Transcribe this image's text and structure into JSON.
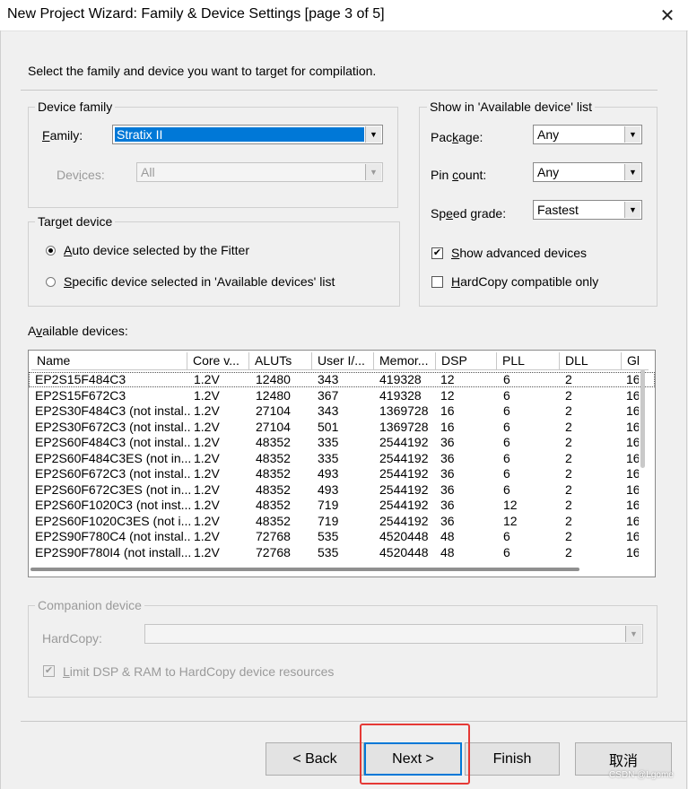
{
  "window": {
    "title": "New Project Wizard: Family & Device Settings [page 3 of 5]",
    "close_glyph": "✕"
  },
  "intro": "Select the family and device you want to target for compilation.",
  "device_family": {
    "group_label": "Device family",
    "family_label_u": "F",
    "family_label_rest": "amily:",
    "family_value": "Stratix II",
    "devices_label_a": "Dev",
    "devices_label_u": "i",
    "devices_label_b": "ces:",
    "devices_value": "All"
  },
  "target_device": {
    "group_label": "Target device",
    "auto_u": "A",
    "auto_rest": "uto device selected by the Fitter",
    "specific_u": "S",
    "specific_rest": "pecific device selected in 'Available devices' list",
    "selected": "auto"
  },
  "show_list": {
    "group_label": "Show in 'Available device' list",
    "package_label_a": "Pac",
    "package_label_u": "k",
    "package_label_b": "age:",
    "package_value": "Any",
    "pin_count_label_a": "Pin ",
    "pin_count_label_u": "c",
    "pin_count_label_b": "ount:",
    "pin_count_value": "Any",
    "speed_label_a": "Sp",
    "speed_label_u": "e",
    "speed_label_b": "ed grade:",
    "speed_value": "Fastest",
    "show_advanced_u": "S",
    "show_advanced_rest": "how advanced devices",
    "show_advanced_checked": true,
    "hardcopy_only_u": "H",
    "hardcopy_only_rest": "ardCopy compatible only",
    "hardcopy_only_checked": false
  },
  "available": {
    "label_a": "A",
    "label_u": "v",
    "label_b": "ailable devices:",
    "columns": [
      "Name",
      "Core v...",
      "ALUTs",
      "User I/...",
      "Memor...",
      "DSP",
      "PLL",
      "DLL",
      "Gl"
    ],
    "rows": [
      [
        "EP2S15F484C3",
        "1.2V",
        "12480",
        "343",
        "419328",
        "12",
        "6",
        "2",
        "16"
      ],
      [
        "EP2S15F672C3",
        "1.2V",
        "12480",
        "367",
        "419328",
        "12",
        "6",
        "2",
        "16"
      ],
      [
        "EP2S30F484C3 (not instal...",
        "1.2V",
        "27104",
        "343",
        "1369728",
        "16",
        "6",
        "2",
        "16"
      ],
      [
        "EP2S30F672C3 (not instal...",
        "1.2V",
        "27104",
        "501",
        "1369728",
        "16",
        "6",
        "2",
        "16"
      ],
      [
        "EP2S60F484C3 (not instal...",
        "1.2V",
        "48352",
        "335",
        "2544192",
        "36",
        "6",
        "2",
        "16"
      ],
      [
        "EP2S60F484C3ES (not in...",
        "1.2V",
        "48352",
        "335",
        "2544192",
        "36",
        "6",
        "2",
        "16"
      ],
      [
        "EP2S60F672C3 (not instal...",
        "1.2V",
        "48352",
        "493",
        "2544192",
        "36",
        "6",
        "2",
        "16"
      ],
      [
        "EP2S60F672C3ES (not in...",
        "1.2V",
        "48352",
        "493",
        "2544192",
        "36",
        "6",
        "2",
        "16"
      ],
      [
        "EP2S60F1020C3 (not inst...",
        "1.2V",
        "48352",
        "719",
        "2544192",
        "36",
        "12",
        "2",
        "16"
      ],
      [
        "EP2S60F1020C3ES (not i...",
        "1.2V",
        "48352",
        "719",
        "2544192",
        "36",
        "12",
        "2",
        "16"
      ],
      [
        "EP2S90F780C4 (not instal...",
        "1.2V",
        "72768",
        "535",
        "4520448",
        "48",
        "6",
        "2",
        "16"
      ],
      [
        "EP2S90F780I4 (not install...",
        "1.2V",
        "72768",
        "535",
        "4520448",
        "48",
        "6",
        "2",
        "16"
      ]
    ],
    "selected_row": 0
  },
  "companion": {
    "group_label": "Companion device",
    "hardcopy_label": "HardCopy:",
    "hardcopy_value": "",
    "limit_u": "L",
    "limit_rest": "imit DSP & RAM to HardCopy device resources",
    "limit_checked": true
  },
  "buttons": {
    "back": "< Back",
    "next": "Next >",
    "finish": "Finish",
    "cancel": "取消"
  },
  "watermark": "CSDN @Lgome",
  "colors": {
    "highlight": "#0078d7",
    "annotation_box": "#e53935"
  }
}
